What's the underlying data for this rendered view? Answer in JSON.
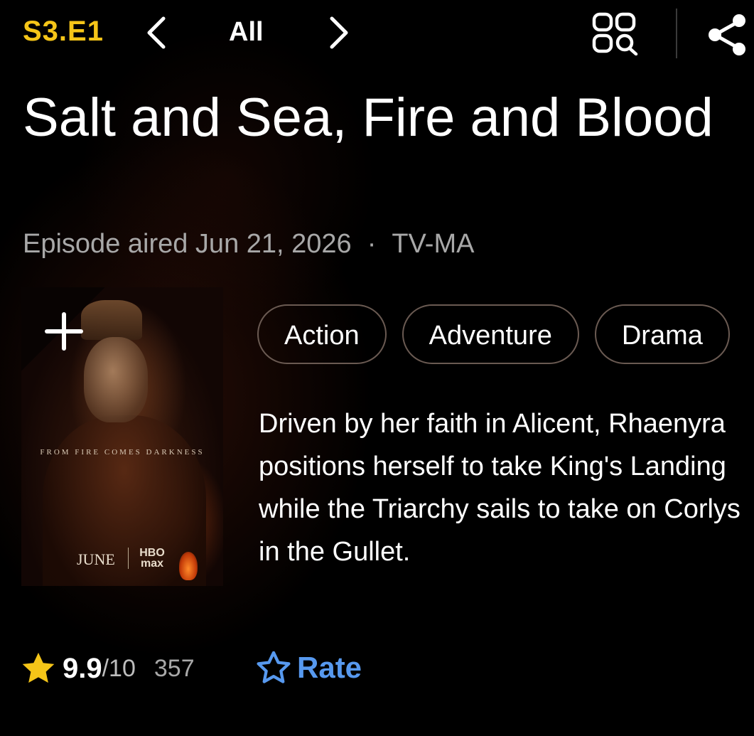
{
  "header": {
    "episode_code": "S3.E1",
    "filter_label": "All"
  },
  "title": "Salt and Sea, Fire and Blood",
  "meta": {
    "aired": "Episode aired Jun 21, 2026",
    "separator": "·",
    "rating": "TV-MA"
  },
  "poster": {
    "tagline": "FROM FIRE COMES DARKNESS",
    "release": "JUNE",
    "brand_top": "HBO",
    "brand_bottom": "max"
  },
  "genres": [
    "Action",
    "Adventure",
    "Drama"
  ],
  "plot": "Driven by her faith in Alicent, Rhaenyra positions herself to take King's Landing while the Triarchy sails to take on Corlys in the Gullet.",
  "rating": {
    "score": "9.9",
    "out_of": "/10",
    "count": "357",
    "rate_label": "Rate"
  },
  "colors": {
    "accent": "#f5c518",
    "rate_blue": "#5799ef",
    "background": "#000000"
  }
}
